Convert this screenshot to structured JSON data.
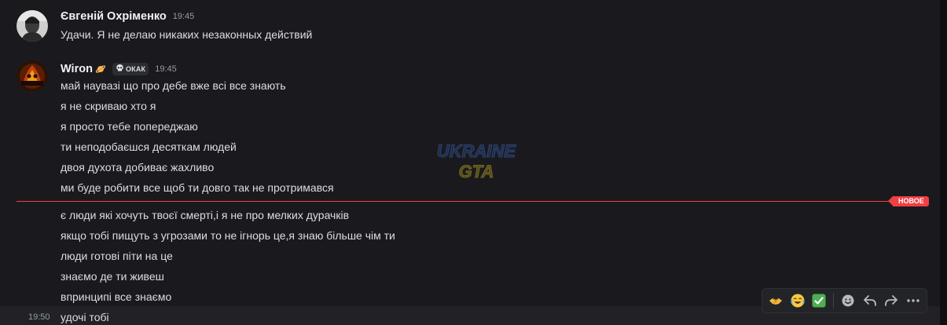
{
  "messages": [
    {
      "author": "Євгеній Охріменко",
      "time": "19:45",
      "lines": [
        "Удачи. Я не делаю никаких незаконных действий"
      ]
    },
    {
      "author": "Wiron",
      "time": "19:45",
      "tag": "ОКАК",
      "lines": [
        "май наувазі що про дебе вже всі все знають",
        "я не скриваю хто я",
        "я просто тебе попереджаю",
        "ти неподобаєшся десяткам людей",
        "двоя духота добиває жахливо",
        "ми буде робити все щоб ти довго так не протримався"
      ]
    }
  ],
  "new_divider": {
    "label": "НОВОЕ",
    "color": "#f23f43"
  },
  "new_messages": [
    "є люди які хочуть твоєї смерті,і я не про мелких дурачків",
    "якщо тобі пищуть з угрозами то не ігнорь це,я знаю більше чім ти",
    "люди готові піти на це",
    "знаємо де ти живеш",
    "впринципі все знаємо"
  ],
  "hovered_message": {
    "time": "19:50",
    "text": "удочі тобі"
  },
  "watermark": {
    "line1": "UKRAINE",
    "line2": "GTA"
  },
  "toolbar": {
    "quick_reactions": [
      "handshake-emoji",
      "joy-emoji",
      "check-mark-emoji"
    ],
    "actions": [
      "add-reaction-icon",
      "reply-icon",
      "forward-icon",
      "more-icon"
    ]
  },
  "colors": {
    "background": "#1a1a1e",
    "text": "#dbdee1",
    "muted": "#949ba4",
    "accent_red": "#f23f43"
  }
}
